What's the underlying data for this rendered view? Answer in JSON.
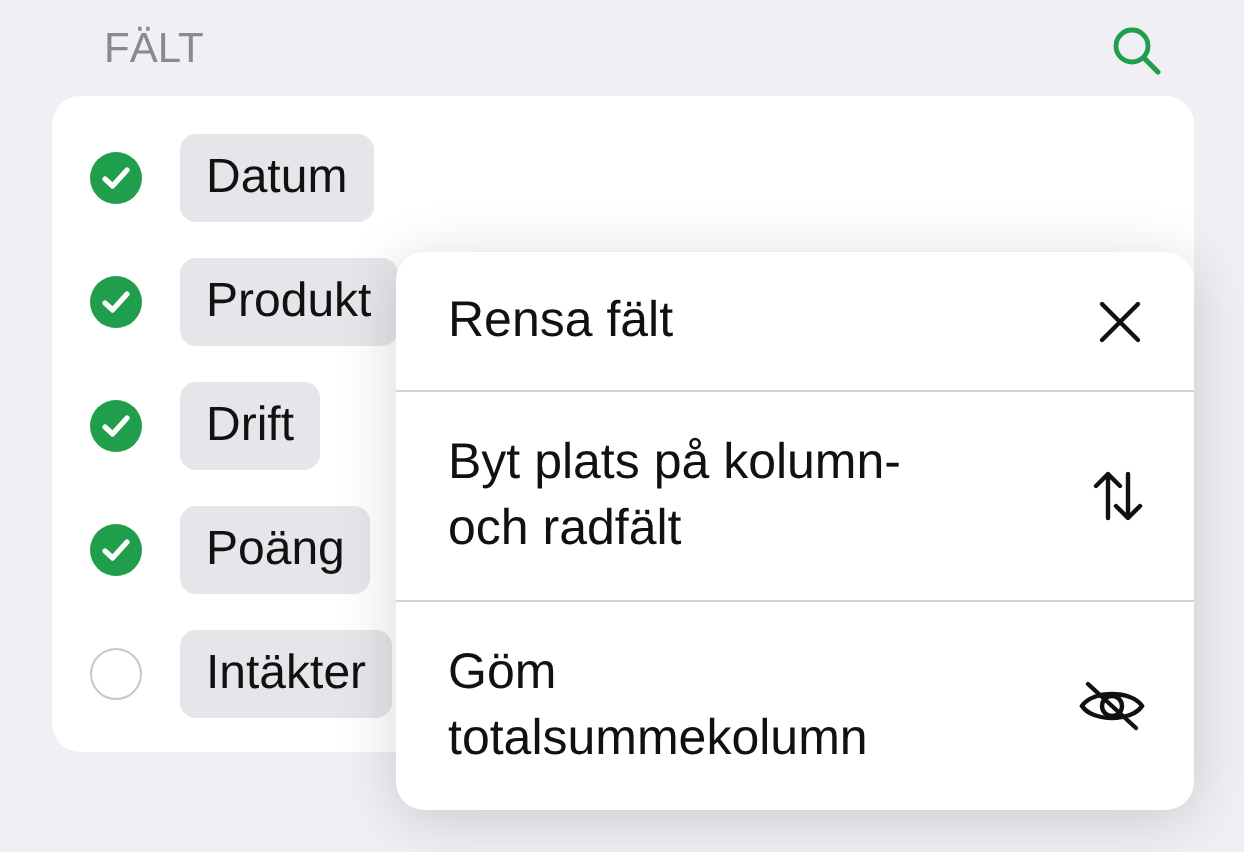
{
  "header": {
    "title": "FÄLT"
  },
  "fields": [
    {
      "label": "Datum",
      "checked": true
    },
    {
      "label": "Produkt",
      "checked": true
    },
    {
      "label": "Drift",
      "checked": true
    },
    {
      "label": "Poäng",
      "checked": true
    },
    {
      "label": "Intäkter",
      "checked": false
    }
  ],
  "menu": {
    "items": [
      {
        "label": "Rensa fält"
      },
      {
        "label": "Byt plats på kolumn- och radfält"
      },
      {
        "label": "Göm totalsummekolumn"
      }
    ]
  }
}
